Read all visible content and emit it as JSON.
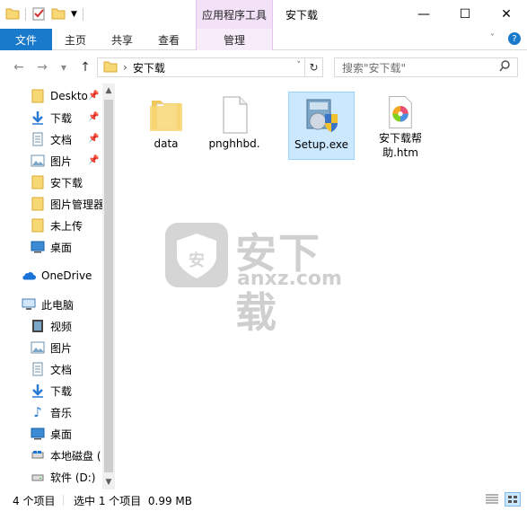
{
  "window": {
    "title": "安下载",
    "context_tab_group": "应用程序工具",
    "controls": {
      "minimize": "—",
      "maximize": "☐",
      "close": "✕"
    }
  },
  "ribbon": {
    "tabs": [
      {
        "label": "文件"
      },
      {
        "label": "主页"
      },
      {
        "label": "共享"
      },
      {
        "label": "查看"
      },
      {
        "label": "管理"
      }
    ]
  },
  "address": {
    "path": [
      "安下载"
    ],
    "search_placeholder": "搜索\"安下载\""
  },
  "nav": {
    "items": [
      {
        "label": "Deskto",
        "icon": "folder-icon",
        "pinned": true
      },
      {
        "label": "下载",
        "icon": "download-icon",
        "pinned": true
      },
      {
        "label": "文档",
        "icon": "document-icon",
        "pinned": true
      },
      {
        "label": "图片",
        "icon": "picture-icon",
        "pinned": true
      },
      {
        "label": "安下载",
        "icon": "folder-icon",
        "pinned": false
      },
      {
        "label": "图片管理器",
        "icon": "folder-icon",
        "pinned": false
      },
      {
        "label": "未上传",
        "icon": "folder-icon",
        "pinned": false
      },
      {
        "label": "桌面",
        "icon": "desktop-icon",
        "pinned": false
      },
      {
        "label": "OneDrive",
        "icon": "cloud-icon",
        "pinned": false
      },
      {
        "label": "此电脑",
        "icon": "computer-icon",
        "pinned": false
      },
      {
        "label": "视频",
        "icon": "video-icon",
        "pinned": false
      },
      {
        "label": "图片",
        "icon": "picture-icon",
        "pinned": false
      },
      {
        "label": "文档",
        "icon": "document-icon",
        "pinned": false
      },
      {
        "label": "下载",
        "icon": "download-icon",
        "pinned": false
      },
      {
        "label": "音乐",
        "icon": "music-icon",
        "pinned": false
      },
      {
        "label": "桌面",
        "icon": "desktop-icon",
        "pinned": false
      },
      {
        "label": "本地磁盘 (",
        "icon": "drive-icon",
        "pinned": false
      },
      {
        "label": "软件 (D:)",
        "icon": "drive-icon",
        "pinned": false
      }
    ]
  },
  "files": [
    {
      "name": "data",
      "icon": "folder-icon",
      "selected": false
    },
    {
      "name": "pnghhbd.",
      "icon": "file-icon",
      "selected": false
    },
    {
      "name": "Setup.exe",
      "icon": "installer-icon",
      "selected": true
    },
    {
      "name": "安下载帮助.htm",
      "icon": "html-file-icon",
      "selected": false
    }
  ],
  "watermark": {
    "text": "安下载",
    "subtext": "anxz.com",
    "badge": "安"
  },
  "status": {
    "count": "4 个项目",
    "selection": "选中 1 个项目  0.99 MB"
  },
  "colors": {
    "file_tab": "#1979ca",
    "context_tab": "#f2e1f7",
    "selection": "#cce8ff"
  }
}
